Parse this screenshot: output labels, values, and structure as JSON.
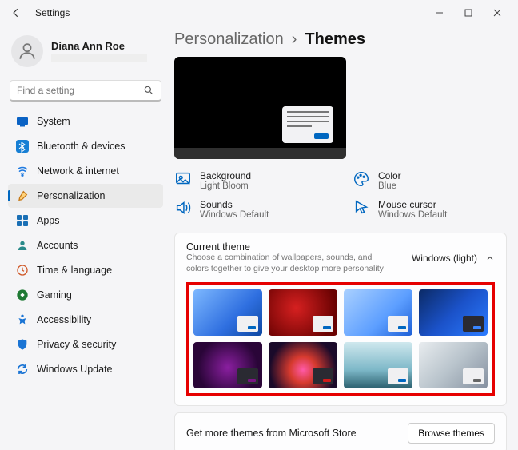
{
  "window": {
    "title": "Settings"
  },
  "profile": {
    "name": "Diana Ann Roe"
  },
  "search": {
    "placeholder": "Find a setting"
  },
  "nav": {
    "items": [
      {
        "label": "System"
      },
      {
        "label": "Bluetooth & devices"
      },
      {
        "label": "Network & internet"
      },
      {
        "label": "Personalization"
      },
      {
        "label": "Apps"
      },
      {
        "label": "Accounts"
      },
      {
        "label": "Time & language"
      },
      {
        "label": "Gaming"
      },
      {
        "label": "Accessibility"
      },
      {
        "label": "Privacy & security"
      },
      {
        "label": "Windows Update"
      }
    ]
  },
  "breadcrumb": {
    "parent": "Personalization",
    "sep": "›",
    "current": "Themes"
  },
  "props": {
    "background": {
      "label": "Background",
      "value": "Light Bloom"
    },
    "color": {
      "label": "Color",
      "value": "Blue"
    },
    "sounds": {
      "label": "Sounds",
      "value": "Windows Default"
    },
    "cursor": {
      "label": "Mouse cursor",
      "value": "Windows Default"
    }
  },
  "currentTheme": {
    "title": "Current theme",
    "desc": "Choose a combination of wallpapers, sounds, and colors together to give your desktop more personality",
    "value": "Windows (light)"
  },
  "store": {
    "text": "Get more themes from Microsoft Store",
    "button": "Browse themes"
  },
  "themes": [
    {
      "bg": "linear-gradient(135deg,#7db8ff 0%,#2f6fe0 60%,#0d47a1 100%)",
      "miniMode": "light",
      "miniBtn": "#0067c0"
    },
    {
      "bg": "radial-gradient(circle at 40% 40%, #d62020 0%, #6a0202 80%)",
      "miniMode": "light",
      "miniBtn": "#0067c0"
    },
    {
      "bg": "linear-gradient(135deg,#a9d0ff 0%,#5c9eff 60%,#1d5fd6 100%)",
      "miniMode": "light",
      "miniBtn": "#0067c0"
    },
    {
      "bg": "linear-gradient(135deg,#0b2a66 0%,#1b52c9 50%,#2b7bff 100%)",
      "miniMode": "dark",
      "miniBtn": "#3a86ff"
    },
    {
      "bg": "radial-gradient(circle at 50% 55%, #8a1fa0 0%, #2a0538 70%)",
      "miniMode": "dark",
      "miniBtn": "#7a1585"
    },
    {
      "bg": "radial-gradient(circle at 50% 60%, #ff5aa8 0%, #d63a2e 30%, #1a0a2a 75%)",
      "miniMode": "dark",
      "miniBtn": "#d11a1a"
    },
    {
      "bg": "linear-gradient(180deg,#cfe8ee 0%,#7db8c8 60%,#2a5f6e 100%)",
      "miniMode": "light",
      "miniBtn": "#0067c0"
    },
    {
      "bg": "linear-gradient(135deg,#e8ecef 0%,#b9c4cc 50%,#8590a0 100%)",
      "miniMode": "light",
      "miniBtn": "#666"
    }
  ],
  "navStyles": {
    "system": {
      "bg": "#0a62c4"
    },
    "bt": {
      "bg": "#177fd4"
    },
    "net": {
      "bg": "none"
    },
    "pers": {
      "bg": "none"
    },
    "apps": {
      "bg": "#1a6fb5"
    },
    "acct": {
      "bg": "#2a8a8a"
    },
    "time": {
      "bg": "#d05a2a"
    },
    "game": {
      "bg": "#1f7a34"
    },
    "access": {
      "bg": "#1a74d4"
    },
    "priv": {
      "bg": "#1a74d4"
    },
    "update": {
      "bg": "#1a74d4"
    }
  }
}
